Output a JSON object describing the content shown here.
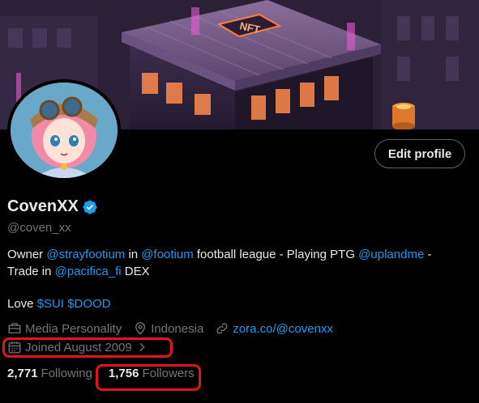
{
  "profile": {
    "display_name": "CovenXX",
    "handle": "@coven_xx",
    "edit_button": "Edit profile"
  },
  "bio": {
    "line1": [
      {
        "text": "Owner ",
        "link": false
      },
      {
        "text": "@strayfootium",
        "link": true
      },
      {
        "text": " in ",
        "link": false
      },
      {
        "text": "@footium",
        "link": true
      },
      {
        "text": " football league - Playing PTG ",
        "link": false
      },
      {
        "text": "@uplandme",
        "link": true
      },
      {
        "text": " -",
        "link": false
      }
    ],
    "line2": [
      {
        "text": "Trade in ",
        "link": false
      },
      {
        "text": "@pacifica_fi",
        "link": true
      },
      {
        "text": " DEX",
        "link": false
      }
    ],
    "line3": [
      {
        "text": "Love ",
        "link": false
      },
      {
        "text": "$SUI",
        "link": true
      },
      {
        "text": " ",
        "link": false
      },
      {
        "text": "$DOOD",
        "link": true
      }
    ]
  },
  "meta": {
    "category": "Media Personality",
    "location": "Indonesia",
    "website": "zora.co/@covenxx",
    "joined": "Joined August 2009"
  },
  "stats": {
    "following_count": "2,771",
    "following_label": "Following",
    "followers_count": "1,756",
    "followers_label": "Followers"
  },
  "banner": {
    "sign_text": "NFT"
  },
  "colors": {
    "accent": "#1d9bf0",
    "annotation": "#e4141b",
    "muted": "#71767b"
  }
}
